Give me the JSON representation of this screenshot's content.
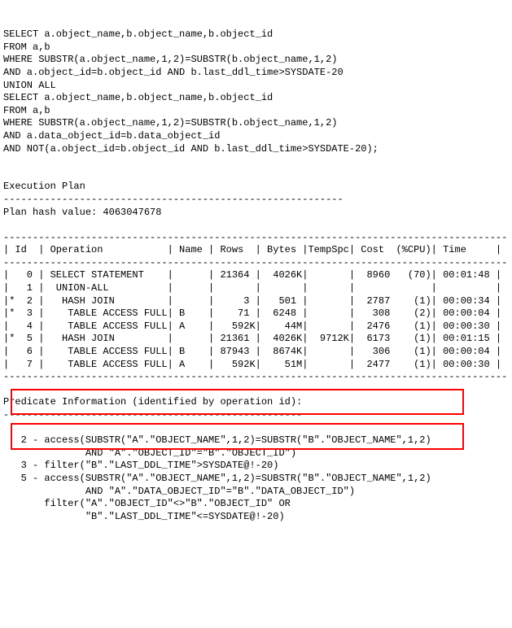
{
  "sql": [
    "SELECT a.object_name,b.object_name,b.object_id",
    "FROM a,b",
    "WHERE SUBSTR(a.object_name,1,2)=SUBSTR(b.object_name,1,2)",
    "AND a.object_id=b.object_id AND b.last_ddl_time>SYSDATE-20",
    "UNION ALL",
    "SELECT a.object_name,b.object_name,b.object_id",
    "FROM a,b",
    "WHERE SUBSTR(a.object_name,1,2)=SUBSTR(b.object_name,1,2)",
    "AND a.data_object_id=b.data_object_id",
    "AND NOT(a.object_id=b.object_id AND b.last_ddl_time>SYSDATE-20);"
  ],
  "plan": {
    "heading": "Execution Plan",
    "divider": "----------------------------------------------------------",
    "hash": "Plan hash value: 4063047678",
    "table_border": "--------------------------------------------------------------------------------------",
    "header": "| Id  | Operation           | Name | Rows  | Bytes |TempSpc| Cost  (%CPU)| Time     |",
    "rows": [
      "|   0 | SELECT STATEMENT    |      | 21364 |  4026K|       |  8960   (70)| 00:01:48 |",
      "|   1 |  UNION-ALL          |      |       |       |       |             |          |",
      "|*  2 |   HASH JOIN         |      |     3 |   501 |       |  2787    (1)| 00:00:34 |",
      "|*  3 |    TABLE ACCESS FULL| B    |    71 |  6248 |       |   308    (2)| 00:00:04 |",
      "|   4 |    TABLE ACCESS FULL| A    |   592K|    44M|       |  2476    (1)| 00:00:30 |",
      "|*  5 |   HASH JOIN         |      | 21361 |  4026K|  9712K|  6173    (1)| 00:01:15 |",
      "|   6 |    TABLE ACCESS FULL| B    | 87943 |  8674K|       |   306    (1)| 00:00:04 |",
      "|   7 |    TABLE ACCESS FULL| A    |   592K|    51M|       |  2477    (1)| 00:00:30 |"
    ]
  },
  "predicate": {
    "heading": "Predicate Information (identified by operation id):",
    "divider": "---------------------------------------------------",
    "lines": [
      "   2 - access(SUBSTR(\"A\".\"OBJECT_NAME\",1,2)=SUBSTR(\"B\".\"OBJECT_NAME\",1,2)",
      "              AND \"A\".\"OBJECT_ID\"=\"B\".\"OBJECT_ID\")",
      "   3 - filter(\"B\".\"LAST_DDL_TIME\">SYSDATE@!-20)",
      "   5 - access(SUBSTR(\"A\".\"OBJECT_NAME\",1,2)=SUBSTR(\"B\".\"OBJECT_NAME\",1,2)",
      "              AND \"A\".\"DATA_OBJECT_ID\"=\"B\".\"DATA_OBJECT_ID\")",
      "       filter(\"A\".\"OBJECT_ID\"<>\"B\".\"OBJECT_ID\" OR",
      "              \"B\".\"LAST_DDL_TIME\"<=SYSDATE@!-20)"
    ]
  }
}
